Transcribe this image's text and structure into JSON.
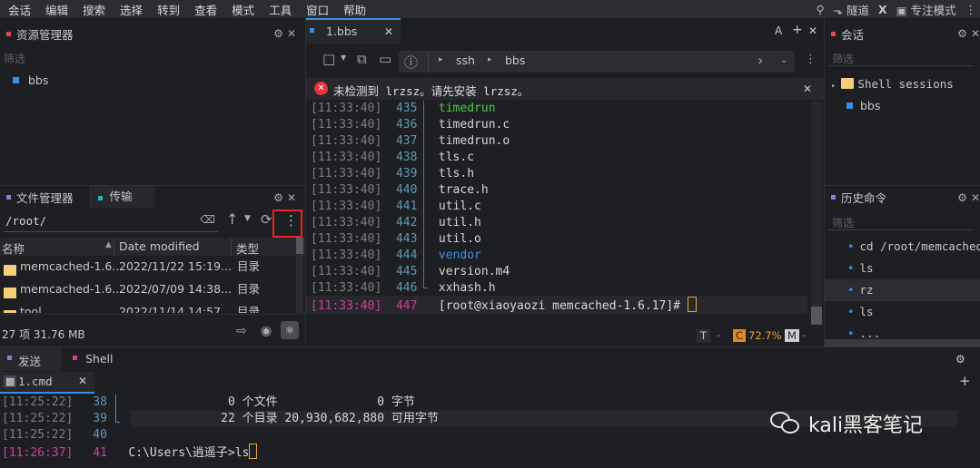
{
  "menubar": {
    "items": [
      "会话",
      "编辑",
      "搜索",
      "选择",
      "转到",
      "查看",
      "模式",
      "工具",
      "窗口",
      "帮助"
    ],
    "right": {
      "tunnel": "隧道",
      "x": "X",
      "focus": "专注模式"
    }
  },
  "left_top": {
    "title": "资源管理器",
    "filter_placeholder": "筛选",
    "item": "bbs"
  },
  "file_manager": {
    "tab1": "文件管理器",
    "tab2": "传输",
    "path": "/root/",
    "headers": {
      "name": "名称",
      "date": "Date modified",
      "type": "类型"
    },
    "rows": [
      {
        "name": "memcached-1.6...",
        "date": "2022/11/22 15:19...",
        "type": "目录"
      },
      {
        "name": "memcached-1.6...",
        "date": "2022/07/09 14:38...",
        "type": "目录"
      },
      {
        "name": "tool",
        "date": "2022/11/14 14:57...",
        "type": "目录"
      }
    ],
    "status": "27 项 31.76 MB"
  },
  "terminal": {
    "tab": "1.bbs",
    "breadcrumb": [
      "ssh",
      "bbs"
    ],
    "warning": "未检测到 lrzsz。请先安装 lrzsz。",
    "lines": [
      {
        "ts": "[11:33:40]",
        "ln": "435",
        "text": "timedrun",
        "color": "#4ec94e"
      },
      {
        "ts": "[11:33:40]",
        "ln": "436",
        "text": "timedrun.c",
        "color": "#d8d8d8"
      },
      {
        "ts": "[11:33:40]",
        "ln": "437",
        "text": "timedrun.o",
        "color": "#d8d8d8"
      },
      {
        "ts": "[11:33:40]",
        "ln": "438",
        "text": "tls.c",
        "color": "#d8d8d8"
      },
      {
        "ts": "[11:33:40]",
        "ln": "439",
        "text": "tls.h",
        "color": "#d8d8d8"
      },
      {
        "ts": "[11:33:40]",
        "ln": "440",
        "text": "trace.h",
        "color": "#d8d8d8"
      },
      {
        "ts": "[11:33:40]",
        "ln": "441",
        "text": "util.c",
        "color": "#d8d8d8"
      },
      {
        "ts": "[11:33:40]",
        "ln": "442",
        "text": "util.h",
        "color": "#d8d8d8"
      },
      {
        "ts": "[11:33:40]",
        "ln": "443",
        "text": "util.o",
        "color": "#d8d8d8"
      },
      {
        "ts": "[11:33:40]",
        "ln": "444",
        "text": "vendor",
        "color": "#3f8fe0"
      },
      {
        "ts": "[11:33:40]",
        "ln": "445",
        "text": "version.m4",
        "color": "#d8d8d8"
      },
      {
        "ts": "[11:33:40]",
        "ln": "446",
        "text": "xxhash.h",
        "color": "#d8d8d8"
      }
    ],
    "prompt": {
      "ts": "[11:33:40]",
      "ln": "447",
      "text": "[root@xiaoyaozi memcached-1.6.17]# "
    },
    "status": {
      "t": "T",
      "c": "C",
      "pct": "72.7%",
      "m": "M",
      "dash": "-"
    }
  },
  "sessions": {
    "title": "会话",
    "filter_placeholder": "筛选",
    "group": "Shell sessions",
    "item": "bbs"
  },
  "history": {
    "title": "历史命令",
    "filter_placeholder": "筛选",
    "items": [
      "cd /root/memcached-1...",
      "ls",
      "rz",
      "ls",
      "..."
    ]
  },
  "bottom": {
    "tab_send": "发送",
    "tab_shell": "Shell",
    "subtab": "1.cmd",
    "lines": [
      {
        "ts": "[11:25:22]",
        "ln": "38",
        "text": "               0 个文件              0 字节"
      },
      {
        "ts": "[11:25:22]",
        "ln": "39",
        "text": "              22 个目录 20,930,682,880 可用字节"
      },
      {
        "ts": "[11:25:22]",
        "ln": "40",
        "text": ""
      }
    ],
    "prompt": {
      "ts": "[11:26:37]",
      "ln": "41",
      "text": "C:\\Users\\逍遥子>ls"
    }
  },
  "watermark": "kali黑客笔记"
}
